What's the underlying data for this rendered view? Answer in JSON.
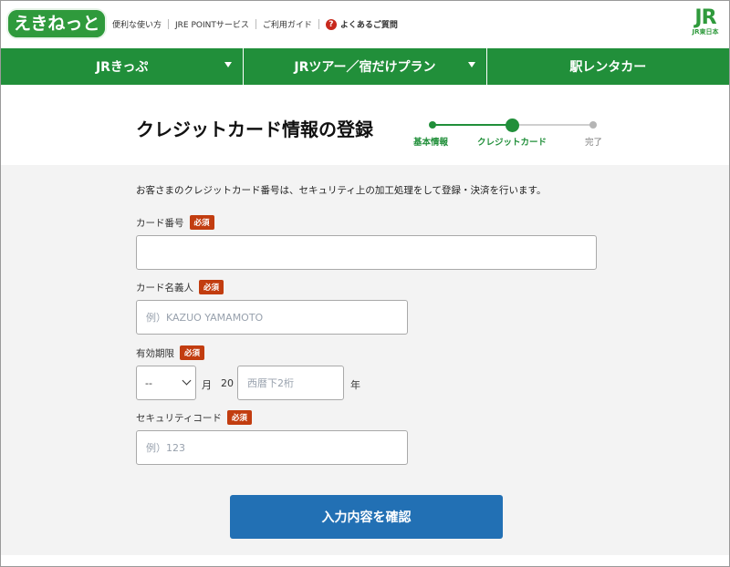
{
  "header": {
    "logo_text": "えきねっと",
    "links": [
      "便利な使い方",
      "JRE POINTサービス",
      "ご利用ガイド"
    ],
    "faq_icon": "?",
    "faq_label": "よくあるご質問",
    "jr_logo": "JR",
    "jr_logo_sub": "JR東日本"
  },
  "nav": {
    "items": [
      {
        "label": "JRきっぷ",
        "has_dropdown": true
      },
      {
        "label": "JRツアー／宿だけプラン",
        "has_dropdown": true
      },
      {
        "label": "駅レンタカー",
        "has_dropdown": false
      }
    ]
  },
  "page": {
    "title": "クレジットカード情報の登録"
  },
  "steps": {
    "items": [
      "基本情報",
      "クレジットカード",
      "完了"
    ],
    "current_index": 1
  },
  "form": {
    "notice": "お客さまのクレジットカード番号は、セキュリティ上の加工処理をして登録・決済を行います。",
    "required_badge": "必須",
    "card_number": {
      "label": "カード番号",
      "value": "",
      "placeholder": ""
    },
    "card_name": {
      "label": "カード名義人",
      "value": "",
      "placeholder": "例）KAZUO YAMAMOTO"
    },
    "expiry": {
      "label": "有効期限",
      "month_selected": "--",
      "month_unit": "月",
      "year_prefix": "20",
      "year_placeholder": "西暦下2桁",
      "year_unit": "年"
    },
    "security_code": {
      "label": "セキュリティコード",
      "value": "",
      "placeholder": "例）123"
    },
    "submit_label": "入力内容を確認"
  },
  "colors": {
    "brand_green": "#218f3a",
    "required_red": "#c23d10",
    "button_blue": "#2270b4"
  }
}
